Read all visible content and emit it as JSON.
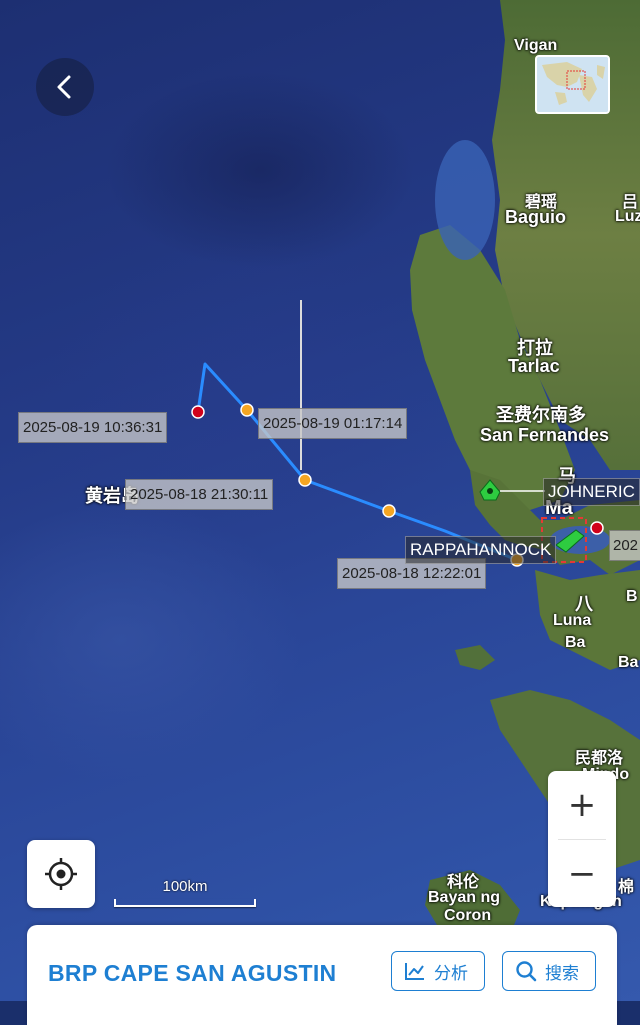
{
  "map": {
    "places": [
      {
        "text": "Vigan",
        "cls": "sm"
      },
      {
        "text": "碧瑶",
        "cls": "sm"
      },
      {
        "text": "Baguio",
        "cls": ""
      },
      {
        "text": "吕",
        "cls": "sm"
      },
      {
        "text": "Luz",
        "cls": "sm"
      },
      {
        "text": "打拉",
        "cls": ""
      },
      {
        "text": "Tarlac",
        "cls": ""
      },
      {
        "text": "圣费尔南多",
        "cls": ""
      },
      {
        "text": "San Fernandes",
        "cls": ""
      },
      {
        "text": "黄岩岛",
        "cls": ""
      },
      {
        "text": "马",
        "cls": ""
      },
      {
        "text": "Ma",
        "cls": ""
      },
      {
        "text": "八",
        "cls": ""
      },
      {
        "text": "Luna",
        "cls": "sm"
      },
      {
        "text": "Ba",
        "cls": "sm"
      },
      {
        "text": "Ba",
        "cls": "sm"
      },
      {
        "text": "B",
        "cls": "sm"
      },
      {
        "text": "民都洛",
        "cls": "sm"
      },
      {
        "text": "Mindo",
        "cls": "sm"
      },
      {
        "text": "科伦",
        "cls": "sm"
      },
      {
        "text": "Bayan ng",
        "cls": "sm"
      },
      {
        "text": "Coron",
        "cls": "sm"
      },
      {
        "text": "Kapatagan",
        "cls": "sm"
      },
      {
        "text": "棉",
        "cls": "sm"
      }
    ],
    "timestamps": [
      "2025-08-19 10:36:31",
      "2025-08-19 01:17:14",
      "2025-08-18 21:30:11",
      "2025-08-18 12:22:01"
    ],
    "ships": {
      "primary": "RAPPAHANNOCK",
      "other": "JOHNERIC",
      "partial_timestamp": "202"
    },
    "scale_label": "100km",
    "zoom_in": "+",
    "zoom_out": "−"
  },
  "card": {
    "vessel_name": "BRP CAPE SAN AGUSTIN",
    "analyze_label": "分析",
    "search_label": "搜索"
  },
  "colors": {
    "track": "#2a8cff",
    "accent": "#1e7fd2",
    "waypoint": "#f5a623",
    "endpoint": "#d0021b",
    "ship_green": "#2ecc40"
  },
  "icons": {
    "back": "chevron-left-icon",
    "locate": "crosshair-icon",
    "analyze": "line-chart-icon",
    "search": "search-icon"
  }
}
